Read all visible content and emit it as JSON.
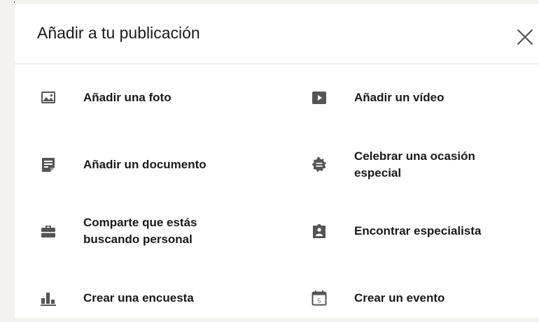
{
  "dialog": {
    "title": "Añadir a tu publicación"
  },
  "icons": {
    "close": "close-icon"
  },
  "items": [
    {
      "label": "Añadir una foto",
      "icon": "photo-icon"
    },
    {
      "label": "Añadir un vídeo",
      "icon": "video-icon"
    },
    {
      "label": "Añadir un documento",
      "icon": "document-icon"
    },
    {
      "label": "Celebrar una ocasión\nespecial",
      "icon": "celebrate-icon"
    },
    {
      "label": "Comparte que estás\nbuscando personal",
      "icon": "briefcase-icon"
    },
    {
      "label": "Encontrar especialista",
      "icon": "specialist-icon"
    },
    {
      "label": "Crear una encuesta",
      "icon": "poll-icon"
    },
    {
      "label": "Crear un evento",
      "icon": "calendar-icon"
    }
  ],
  "calendar_day": "5",
  "colors": {
    "icon": "#555555",
    "text": "rgba(0,0,0,0.9)",
    "divider": "#e0dfdc"
  }
}
